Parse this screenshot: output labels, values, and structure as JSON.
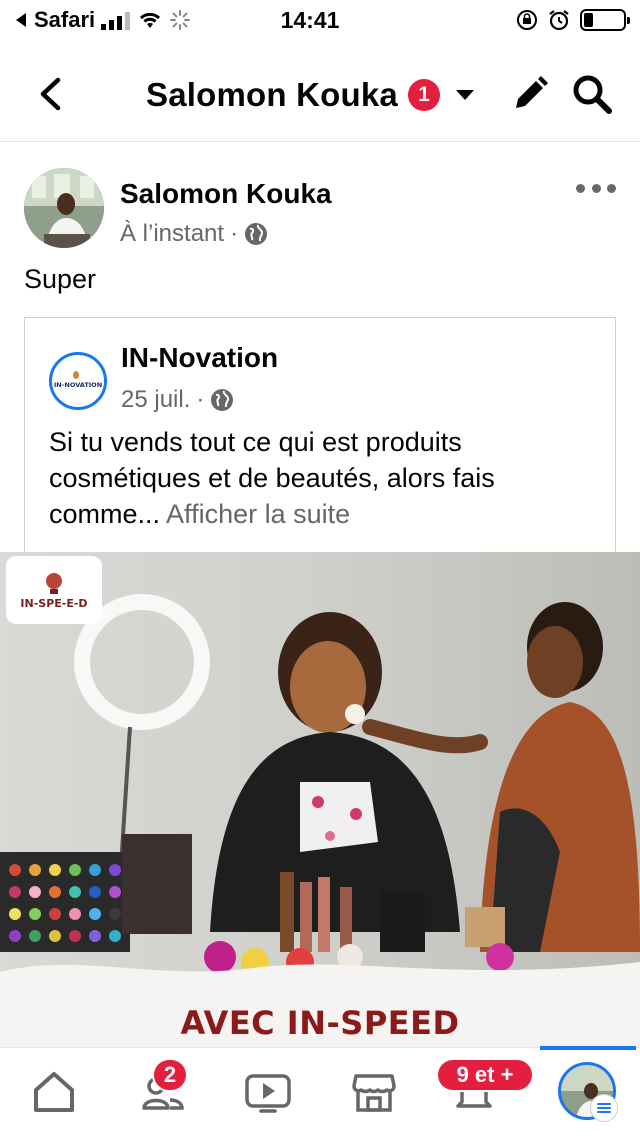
{
  "status_bar": {
    "carrier": "Safari",
    "time": "14:41"
  },
  "header": {
    "title": "Salomon Kouka",
    "notification_count": "1"
  },
  "post": {
    "author": "Salomon Kouka",
    "timestamp": "À l’instant",
    "privacy_icon": "globe-icon",
    "text": "Super"
  },
  "shared_post": {
    "page_name": "IN-Novation",
    "page_logo_text": "IN-NOVATION",
    "date": "25 juil.",
    "text": "Si tu vends tout ce qui est produits cosmétiques et de beautés, alors fais comme...",
    "see_more": "Afficher la suite"
  },
  "image": {
    "logo_text": "IN-SPE-E-D",
    "promo_text": "AVEC IN-SPEED"
  },
  "tab_bar": {
    "friends_badge": "2",
    "notifications_badge": "9 et +"
  },
  "colors": {
    "accent": "#1877f2",
    "badge": "#e41e3f",
    "secondary_text": "#65676b"
  }
}
